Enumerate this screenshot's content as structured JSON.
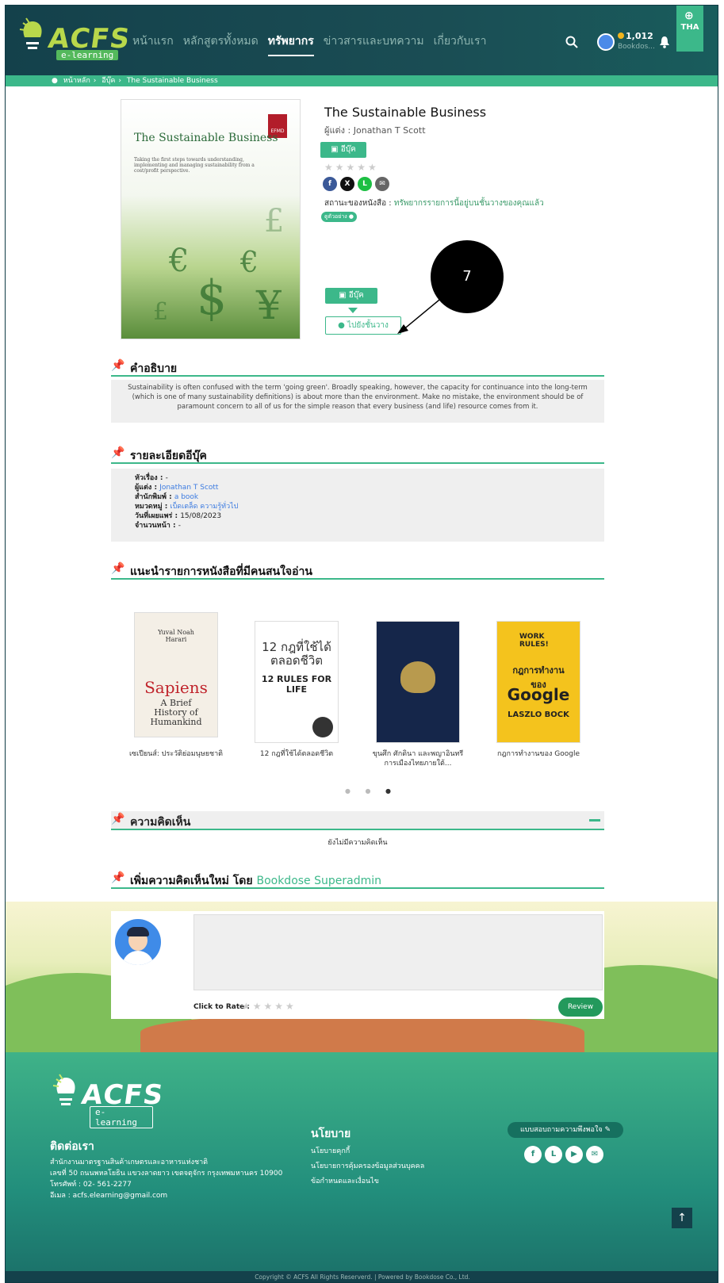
{
  "header": {
    "logo_text": "ACFS",
    "logo_sub": "e-learning",
    "nav": [
      "หน้าแรก",
      "หลักสูตรทั้งหมด",
      "ทรัพยากร",
      "ข่าวสารและบทความ",
      "เกี่ยวกับเรา"
    ],
    "active_nav": "ทรัพยากร",
    "points": "1,012",
    "user": "Bookdos...",
    "lang": "THA"
  },
  "breadcrumb": [
    "หน้าหลัก",
    "อีบุ๊ค",
    "The Sustainable Business"
  ],
  "book": {
    "cover_title": "The Sustainable Business",
    "cover_sub": "Taking the first steps towards understanding, implementing and managing sustainability from a cost/profit perspective.",
    "cover_badge": "EFMD",
    "title": "The Sustainable Business",
    "author_line": "ผู้แต่ง : Jonathan T Scott",
    "type": "อีบุ๊ค",
    "stars": "★★★★★",
    "share": [
      "f",
      "X",
      "L",
      "✉"
    ],
    "status_label": "สถานะของหนังสือ : ",
    "status_value": "ทรัพยากรรายการนี้อยู่บนชั้นวางของคุณแล้ว",
    "sample": "ดูตัวอย่าง",
    "ebook_button": "อีบุ๊ค",
    "shelf_button": "ไปยังชั้นวาง"
  },
  "callout": "7",
  "description": {
    "title": "คำอธิบาย",
    "text": "Sustainability is often confused with the term 'going green'. Broadly speaking, however, the capacity for continuance into the long-term (which is one of many sustainability definitions) is about more than the environment. Make no mistake, the environment should be of paramount concern to all of us for the simple reason that every business (and life) resource comes from it."
  },
  "details": {
    "title": "รายละเอียดอีบุ๊ค",
    "rows": [
      {
        "label": "หัวเรื่อง : ",
        "value": "-"
      },
      {
        "label": "ผู้แต่ง : ",
        "value": "Jonathan T Scott"
      },
      {
        "label": "สำนักพิมพ์ : ",
        "value": "a book"
      },
      {
        "label": "หมวดหมู่ : ",
        "value": "เบ็ดเตล็ด ความรู้ทั่วไป"
      },
      {
        "label": "วันที่เผยแพร่ : ",
        "value": "15/08/2023"
      },
      {
        "label": "จำนวนหน้า : ",
        "value": "-"
      }
    ]
  },
  "recommend": {
    "title": "แนะนำรายการหนังสือที่มีคนสนใจอ่าน",
    "items": [
      {
        "name": "เซเปียนส์: ประวัติย่อมนุษยชาติ",
        "cover_text": "Sapiens"
      },
      {
        "name": "12 กฎที่ใช้ได้ตลอดชีวิต",
        "cover_text": "12 RULES FOR LIFE"
      },
      {
        "name": "ขุนศึก ศักดินา และพญาอินทรี การเมืองไทยภายใต้...",
        "cover_text": ""
      },
      {
        "name": "กฎการทำงานของ Google",
        "cover_text": "Google"
      }
    ]
  },
  "comments": {
    "title": "ความคิดเห็น",
    "empty": "ยังไม่มีความคิดเห็น"
  },
  "add_comment": {
    "title": "เพิ่มความคิดเห็นใหม่ โดย ",
    "user": "Bookdose Superadmin",
    "rate_label": "Click to Rate :",
    "stars": "★★★★★",
    "review_button": "Review"
  },
  "footer": {
    "contact_title": "ติดต่อเรา",
    "contact": [
      "สำนักงานมาตรฐานสินค้าเกษตรและอาหารแห่งชาติ",
      "เลขที่ 50 ถนนพหลโยธิน แขวงลาดยาว เขตจตุจักร กรุงเทพมหานคร 10900",
      "โทรศัพท์ : 02- 561-2277",
      "อีเมล : acfs.elearning@gmail.com"
    ],
    "policy_title": "นโยบาย",
    "policy": [
      "นโยบายคุกกี้",
      "นโยบายการคุ้มครองข้อมูลส่วนบุคคล",
      "ข้อกำหนดและเงื่อนไข"
    ],
    "survey": "แบบสอบถามความพึงพอใจ",
    "copyright": "Copyright © ACFS All Rights Reserverd. | Powered by Bookdose Co., Ltd."
  }
}
